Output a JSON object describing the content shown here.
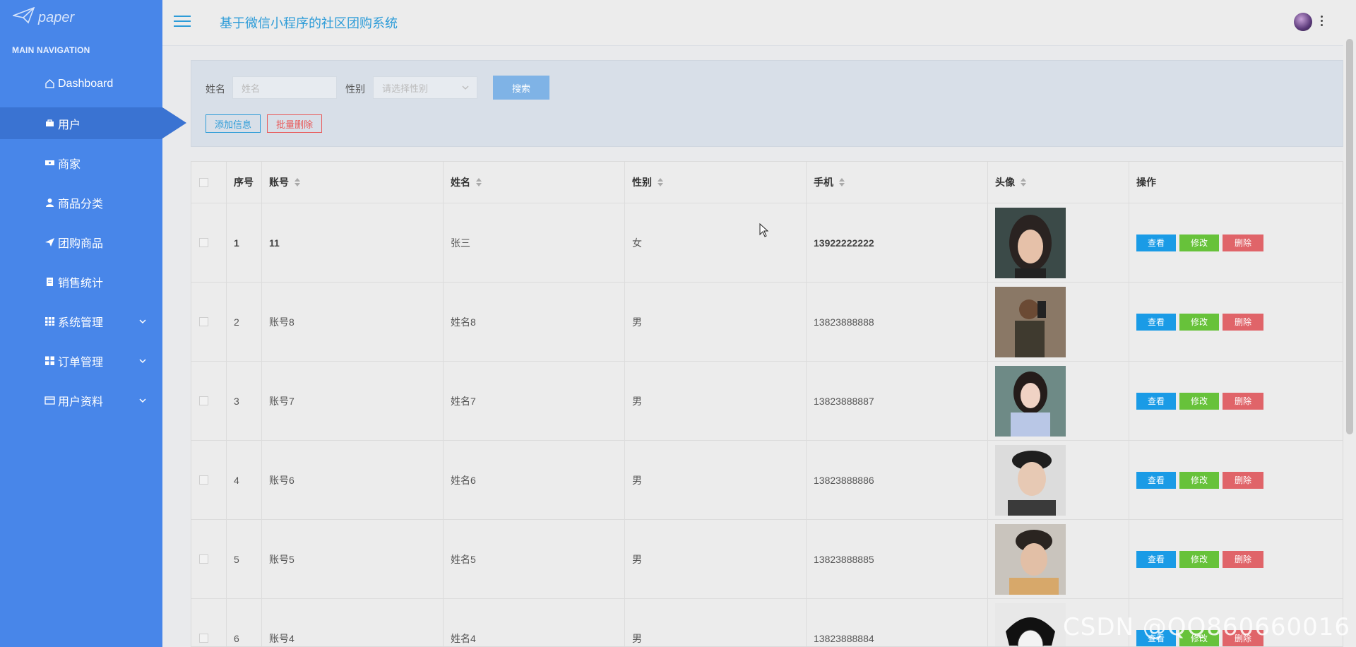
{
  "app": {
    "logo_text": "paper",
    "title": "基于微信小程序的社区团购系统"
  },
  "sidebar": {
    "section_title": "MAIN NAVIGATION",
    "items": [
      {
        "label": "Dashboard",
        "icon": "home-icon"
      },
      {
        "label": "用户",
        "icon": "briefcase-icon"
      },
      {
        "label": "商家",
        "icon": "ticket-icon"
      },
      {
        "label": "商品分类",
        "icon": "user-icon"
      },
      {
        "label": "团购商品",
        "icon": "send-icon"
      },
      {
        "label": "销售统计",
        "icon": "clipboard-icon"
      },
      {
        "label": "系统管理",
        "icon": "grid-icon"
      },
      {
        "label": "订单管理",
        "icon": "apps-icon"
      },
      {
        "label": "用户资料",
        "icon": "card-icon"
      }
    ],
    "active_index": 1
  },
  "search": {
    "name_label": "姓名",
    "name_placeholder": "姓名",
    "gender_label": "性别",
    "gender_placeholder": "请选择性别",
    "search_button": "搜索",
    "add_button": "添加信息",
    "bulk_delete_button": "批量删除"
  },
  "table": {
    "headers": [
      "序号",
      "账号",
      "姓名",
      "性别",
      "手机",
      "头像",
      "操作"
    ],
    "rows": [
      {
        "index": "1",
        "account": "11",
        "name": "张三",
        "gender": "女",
        "phone": "13922222222"
      },
      {
        "index": "2",
        "account": "账号8",
        "name": "姓名8",
        "gender": "男",
        "phone": "13823888888"
      },
      {
        "index": "3",
        "account": "账号7",
        "name": "姓名7",
        "gender": "男",
        "phone": "13823888887"
      },
      {
        "index": "4",
        "account": "账号6",
        "name": "姓名6",
        "gender": "男",
        "phone": "13823888886"
      },
      {
        "index": "5",
        "account": "账号5",
        "name": "姓名5",
        "gender": "男",
        "phone": "13823888885"
      },
      {
        "index": "6",
        "account": "账号4",
        "name": "姓名4",
        "gender": "男",
        "phone": "13823888884"
      }
    ],
    "actions": {
      "view": "查看",
      "edit": "修改",
      "delete": "删除"
    }
  },
  "watermark": "CSDN @QQ860660016",
  "colors": {
    "sidebar": "#4886e9",
    "active": "#3a73d2",
    "view": "#1a9be6",
    "edit": "#67c23a",
    "delete": "#e06469",
    "title": "#2d9cd8"
  }
}
